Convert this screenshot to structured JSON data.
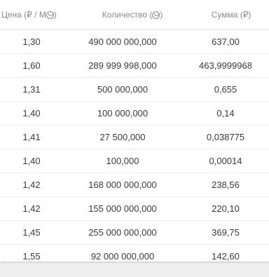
{
  "table": {
    "headers": {
      "price_prefix": "Цена (₽ / М",
      "price_suffix": ")",
      "qty_prefix": "Количество (",
      "qty_suffix": ")",
      "sum": "Сумма (₽)"
    },
    "rows": [
      {
        "price": "1,30",
        "quantity": "490 000 000,000",
        "sum": "637,00"
      },
      {
        "price": "1,60",
        "quantity": "289 999 998,000",
        "sum": "463,9999968"
      },
      {
        "price": "1,31",
        "quantity": "500 000,000",
        "sum": "0,655"
      },
      {
        "price": "1,40",
        "quantity": "100 000,000",
        "sum": "0,14"
      },
      {
        "price": "1,41",
        "quantity": "27 500,000",
        "sum": "0,038775"
      },
      {
        "price": "1,40",
        "quantity": "100,000",
        "sum": "0,00014"
      },
      {
        "price": "1,42",
        "quantity": "168 000 000,000",
        "sum": "238,56"
      },
      {
        "price": "1,42",
        "quantity": "155 000 000,000",
        "sum": "220,10"
      },
      {
        "price": "1,45",
        "quantity": "255 000 000,000",
        "sum": "369,75"
      },
      {
        "price": "1,55",
        "quantity": "92 000 000,000",
        "sum": "142,60"
      }
    ]
  },
  "icons": {
    "currency": "coin-icon"
  }
}
